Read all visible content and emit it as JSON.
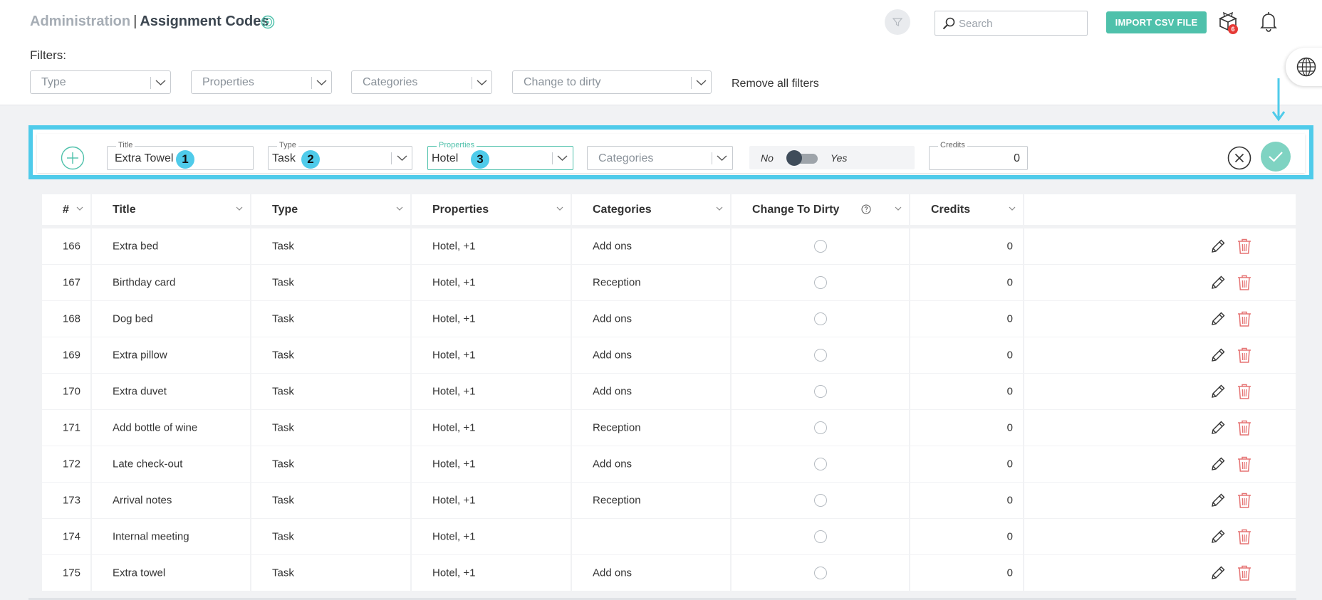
{
  "header": {
    "breadcrumb_parent": "Administration",
    "breadcrumb_sep": "|",
    "page_title": "Assignment Codes",
    "search_placeholder": "Search",
    "import_button": "IMPORT CSV FILE",
    "notification_badge": "6"
  },
  "filters": {
    "label": "Filters:",
    "type": "Type",
    "properties": "Properties",
    "categories": "Categories",
    "change_to_dirty": "Change to dirty",
    "remove_all": "Remove all filters"
  },
  "add_form": {
    "title_label": "Title",
    "title_value": "Extra Towel",
    "type_label": "Type",
    "type_value": "Task",
    "properties_label": "Properties",
    "properties_value": "Hotel",
    "categories_placeholder": "Categories",
    "toggle_no": "No",
    "toggle_yes": "Yes",
    "credits_label": "Credits",
    "credits_value": "0",
    "step_badges": [
      "1",
      "2",
      "3"
    ]
  },
  "table": {
    "columns": [
      "#",
      "Title",
      "Type",
      "Properties",
      "Categories",
      "Change To Dirty",
      "Credits"
    ],
    "rows": [
      {
        "id": "166",
        "title": "Extra bed",
        "type": "Task",
        "properties": "Hotel, +1",
        "categories": "Add ons",
        "credits": "0"
      },
      {
        "id": "167",
        "title": "Birthday card",
        "type": "Task",
        "properties": "Hotel, +1",
        "categories": "Reception",
        "credits": "0"
      },
      {
        "id": "168",
        "title": "Dog bed",
        "type": "Task",
        "properties": "Hotel, +1",
        "categories": "Add ons",
        "credits": "0"
      },
      {
        "id": "169",
        "title": "Extra pillow",
        "type": "Task",
        "properties": "Hotel, +1",
        "categories": "Add ons",
        "credits": "0"
      },
      {
        "id": "170",
        "title": "Extra duvet",
        "type": "Task",
        "properties": "Hotel, +1",
        "categories": "Add ons",
        "credits": "0"
      },
      {
        "id": "171",
        "title": "Add bottle of wine",
        "type": "Task",
        "properties": "Hotel, +1",
        "categories": "Reception",
        "credits": "0"
      },
      {
        "id": "172",
        "title": "Late check-out",
        "type": "Task",
        "properties": "Hotel, +1",
        "categories": "Add ons",
        "credits": "0"
      },
      {
        "id": "173",
        "title": "Arrival notes",
        "type": "Task",
        "properties": "Hotel, +1",
        "categories": "Reception",
        "credits": "0"
      },
      {
        "id": "174",
        "title": "Internal meeting",
        "type": "Task",
        "properties": "Hotel, +1",
        "categories": "",
        "credits": "0"
      },
      {
        "id": "175",
        "title": "Extra towel",
        "type": "Task",
        "properties": "Hotel, +1",
        "categories": "Add ons",
        "credits": "0"
      }
    ]
  },
  "colors": {
    "accent": "#4fc1ab",
    "highlight": "#4fcbea",
    "delete": "#e57373"
  }
}
